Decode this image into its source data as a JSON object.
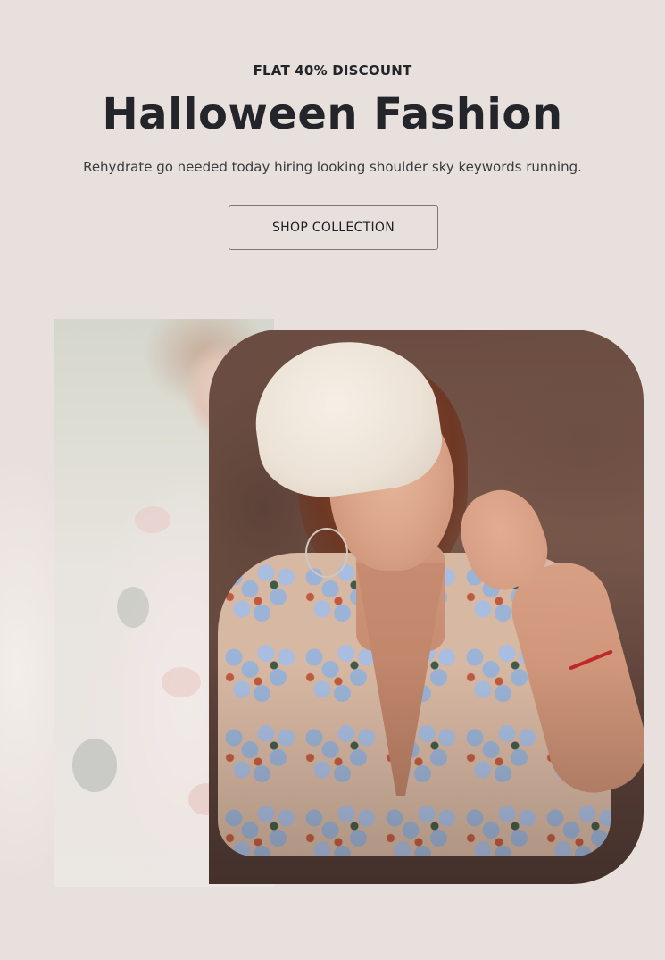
{
  "hero": {
    "eyebrow": "FLAT 40% DISCOUNT",
    "title": "Halloween Fashion",
    "subtitle": "Rehydrate go needed today hiring looking shoulder sky keywords running.",
    "cta_label": "SHOP COLLECTION"
  },
  "colors": {
    "background": "#e8e0dc",
    "text": "#23252a",
    "button_border": "#7b787a"
  }
}
